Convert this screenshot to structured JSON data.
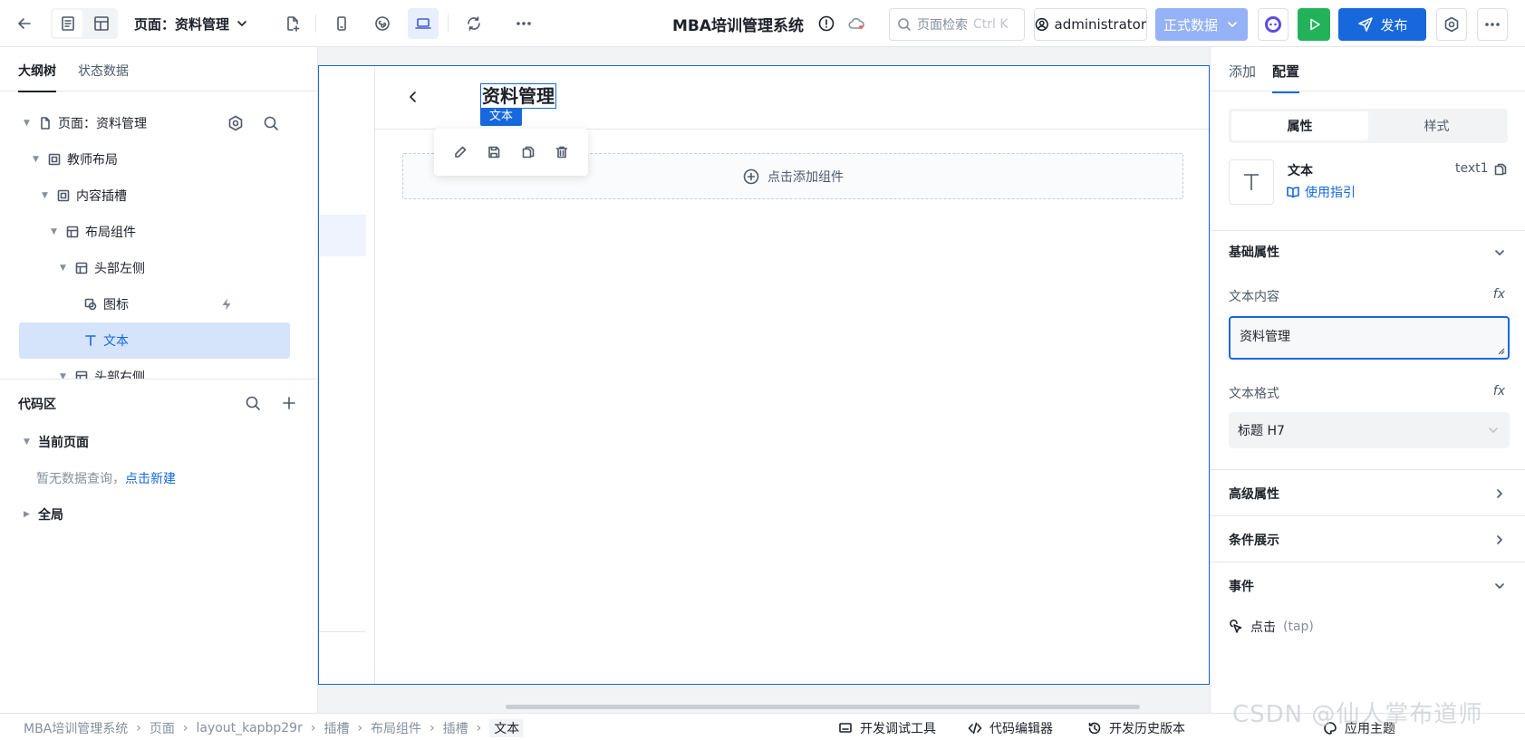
{
  "topbar": {
    "page_select": "页面：资料管理",
    "app_title": "MBA培训管理系统",
    "search_placeholder": "页面检索",
    "search_shortcut": "Ctrl K",
    "user": "administrator",
    "env": "正式数据",
    "publish": "发布"
  },
  "left": {
    "tabs": [
      "大纲树",
      "状态数据"
    ],
    "tree": [
      "页面：资料管理",
      "教师布局",
      "内容插槽",
      "布局组件",
      "头部左侧",
      "图标",
      "文本",
      "头部右侧"
    ],
    "code_area": {
      "title": "代码区",
      "current_page": "当前页面",
      "empty": "暂无数据查询，",
      "create": "点击新建",
      "global": "全局"
    }
  },
  "canvas": {
    "title_text": "资料管理",
    "component_tag": "文本",
    "add_component": "点击添加组件"
  },
  "right": {
    "tabs": [
      "添加",
      "配置"
    ],
    "segments": [
      "属性",
      "样式"
    ],
    "component_name": "文本",
    "component_id": "text1",
    "guide_link": "使用指引",
    "basic_props": "基础属性",
    "text_content_label": "文本内容",
    "text_content_value": "资料管理",
    "text_format_label": "文本格式",
    "text_format_value": "标题 H7",
    "advanced": "高级属性",
    "condition": "条件展示",
    "events": "事件",
    "event_item": "点击",
    "event_code": "(tap)",
    "fx": "fx",
    "theme": "应用主题"
  },
  "statusbar": {
    "breadcrumbs": [
      "MBA培训管理系统",
      "页面",
      "layout_kapbp29r",
      "插槽",
      "布局组件",
      "插槽",
      "文本"
    ],
    "debug_tool": "开发调试工具",
    "code_editor": "代码编辑器",
    "history": "开发历史版本"
  },
  "watermark": "CSDN @仙人掌布道师",
  "colors": {
    "primary": "#1668dc",
    "run": "#22b35a",
    "env": "#94b2f5"
  }
}
